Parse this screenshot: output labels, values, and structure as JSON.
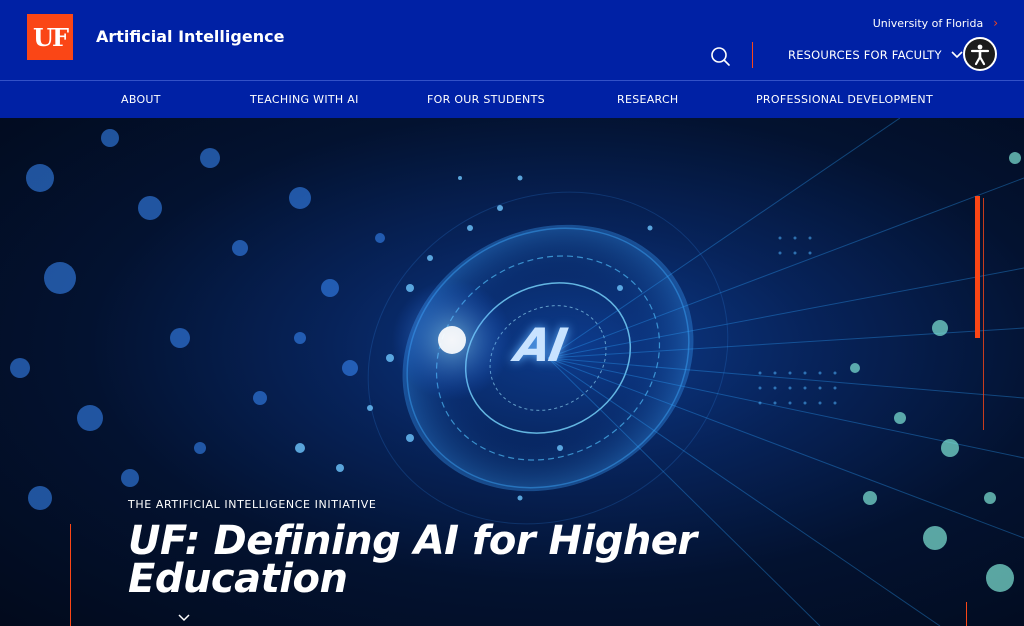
{
  "header": {
    "logo_text": "UF",
    "site_title": "Artificial Intelligence",
    "university_link": "University of Florida",
    "resources_label": "RESOURCES FOR FACULTY",
    "brand_color": "#0021a5",
    "accent_color": "#fa4616"
  },
  "nav": {
    "items": [
      {
        "label": "ABOUT"
      },
      {
        "label": "TEACHING WITH AI"
      },
      {
        "label": "FOR OUR STUDENTS"
      },
      {
        "label": "RESEARCH"
      },
      {
        "label": "PROFESSIONAL DEVELOPMENT"
      }
    ]
  },
  "hero": {
    "ai_text": "AI",
    "eyebrow": "THE ARTIFICIAL INTELLIGENCE INITIATIVE",
    "headline": "UF: Defining AI for Higher Education"
  },
  "icons": {
    "search": "search-icon",
    "chevron": "chevron-down-icon",
    "external": "chevron-right-icon",
    "accessibility": "accessibility-icon"
  }
}
